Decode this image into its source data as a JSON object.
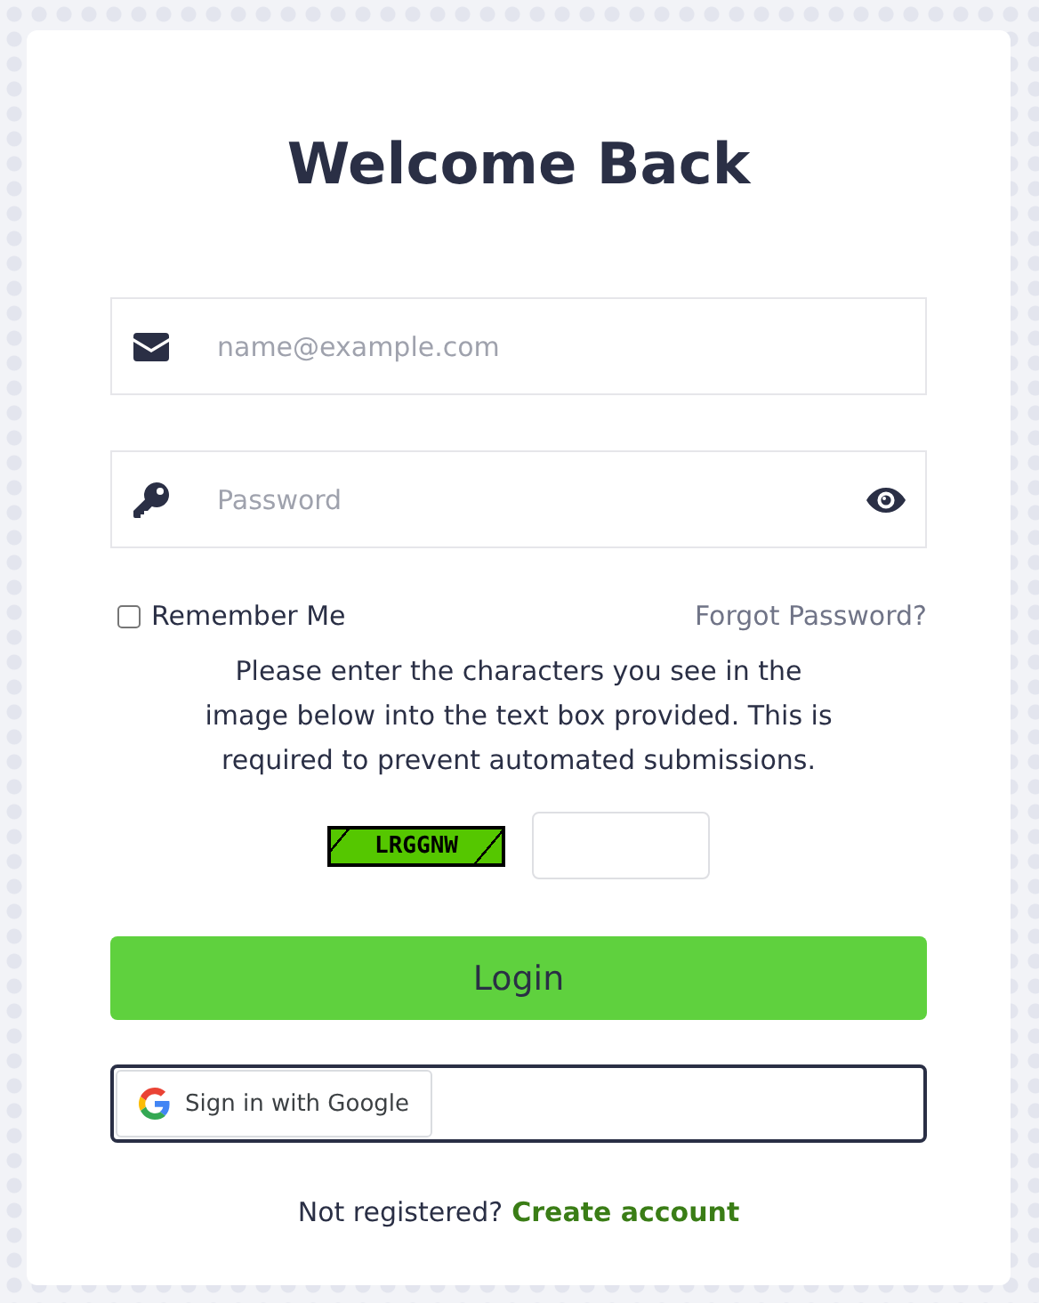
{
  "title": "Welcome Back",
  "fields": [
    {
      "kind": "email",
      "placeholder": "name@example.com"
    },
    {
      "kind": "password",
      "placeholder": "Password"
    }
  ],
  "remember": {
    "label": "Remember Me",
    "checked": false
  },
  "forgot_link": "Forgot Password?",
  "captcha": {
    "instructions": "Please enter the characters you see in the image below into the text box provided. This is required to prevent automated submissions.",
    "code": "LRGGNW"
  },
  "login_button": "Login",
  "google_button": "Sign in with Google",
  "footer": {
    "prompt": "Not registered?",
    "link": "Create account"
  }
}
